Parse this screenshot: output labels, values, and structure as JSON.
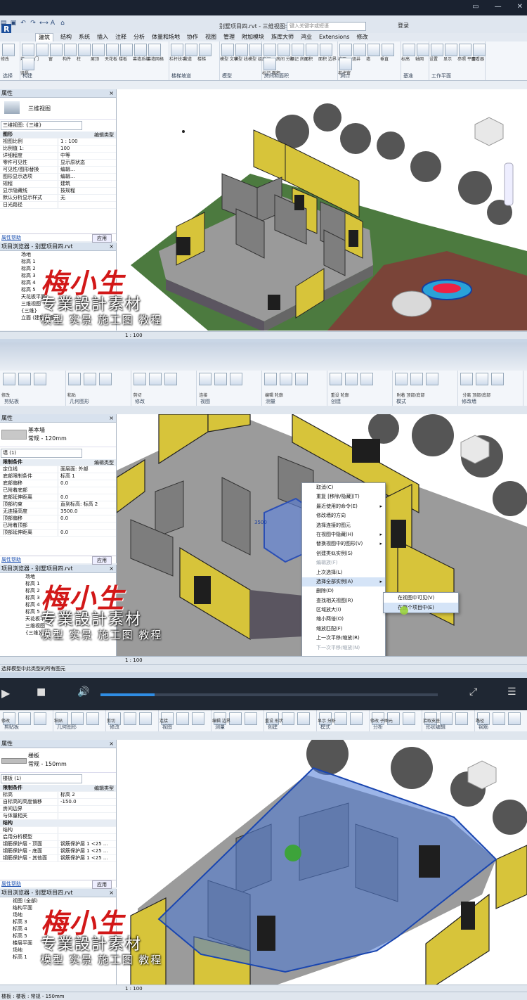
{
  "frame1": {
    "doc_title": "别墅项目四.rvt - 三维视图:...",
    "search_placeholder": "键入关键字或短语",
    "login": "登录",
    "menu_tabs": [
      "建筑",
      "结构",
      "系统",
      "插入",
      "注释",
      "分析",
      "体量和场地",
      "协作",
      "视图",
      "管理",
      "附加模块",
      "族库大师",
      "鸿业",
      "Extensions",
      "修改"
    ],
    "ribbon_groups": [
      {
        "name": "选择",
        "items": [
          "修改"
        ]
      },
      {
        "name": "构建",
        "items": [
          "墙",
          "门",
          "窗",
          "构件",
          "柱",
          "屋顶",
          "天花板",
          "楼板",
          "幕墙系统",
          "幕墙网格",
          "竖梃"
        ]
      },
      {
        "name": "楼梯坡道",
        "items": [
          "栏杆扶手",
          "坡道",
          "楼梯"
        ]
      },
      {
        "name": "模型",
        "items": [
          "模型 文字",
          "模型 线",
          "模型 组"
        ]
      },
      {
        "name": "房间和面积",
        "items": [
          "房间",
          "房间 分隔",
          "标记 房间",
          "面积",
          "面积 边界",
          "标记 面积"
        ]
      },
      {
        "name": "洞口",
        "items": [
          "按面",
          "竖井",
          "墙",
          "垂直",
          "老虎窗"
        ]
      },
      {
        "name": "基准",
        "items": [
          "标高",
          "轴网"
        ]
      },
      {
        "name": "工作平面",
        "items": [
          "设置",
          "显示",
          "参照 平面",
          "查看器"
        ]
      }
    ],
    "properties": {
      "title": "属性",
      "type_name": "三维视图",
      "selector": "三维视图: {三维}",
      "edit_type": "编辑类型",
      "section": "图形",
      "rows": [
        {
          "k": "视图比例",
          "v": "1 : 100"
        },
        {
          "k": "比例值 1:",
          "v": "100"
        },
        {
          "k": "详细程度",
          "v": "中等"
        },
        {
          "k": "零件可见性",
          "v": "显示原状态"
        },
        {
          "k": "可见性/图形替换",
          "v": "编辑..."
        },
        {
          "k": "图形显示选项",
          "v": "编辑..."
        },
        {
          "k": "规程",
          "v": "建筑"
        },
        {
          "k": "显示隐藏线",
          "v": "按规程"
        },
        {
          "k": "默认分析显示样式",
          "v": "无"
        },
        {
          "k": "日光路径",
          "v": ""
        }
      ],
      "help": "属性帮助",
      "apply": "应用"
    },
    "browser": {
      "title": "项目浏览器 - 别墅项目四.rvt",
      "items": [
        "场地",
        "标高 1",
        "标高 2",
        "标高 3",
        "标高 4",
        "标高 5",
        "天花板平面",
        "三维视图",
        "{三维}",
        "立面 (建筑立面)"
      ]
    },
    "status": "1 : 100"
  },
  "frame2": {
    "ribbon_groups": [
      "剪贴板",
      "几何图形",
      "修改",
      "视图",
      "测量",
      "创建",
      "模式",
      "修改墙"
    ],
    "ribbon_items": [
      "修改",
      "粘贴",
      "剪切",
      "连接",
      "编辑 轮廓",
      "重设 轮廓",
      "附着 顶部/底部",
      "分离 顶部/底部"
    ],
    "properties": {
      "title": "属性",
      "type_name": "基本墙",
      "type_sub": "常规 - 120mm",
      "selector": "墙 (1)",
      "edit_type": "编辑类型",
      "section": "限制条件",
      "rows": [
        {
          "k": "定位线",
          "v": "面层面: 外部"
        },
        {
          "k": "底部限制条件",
          "v": "标高 1"
        },
        {
          "k": "底部偏移",
          "v": "0.0"
        },
        {
          "k": "已附着底部",
          "v": ""
        },
        {
          "k": "底部延伸距离",
          "v": "0.0"
        },
        {
          "k": "顶部约束",
          "v": "直到标高: 标高 2"
        },
        {
          "k": "无连接高度",
          "v": "3500.0"
        },
        {
          "k": "顶部偏移",
          "v": "0.0"
        },
        {
          "k": "已附着顶部",
          "v": ""
        },
        {
          "k": "顶部延伸距离",
          "v": "0.0"
        }
      ],
      "help": "属性帮助",
      "apply": "应用"
    },
    "browser": {
      "title": "项目浏览器 - 别墅项目四.rvt",
      "items": [
        "场地",
        "标高 1",
        "标高 2",
        "标高 3",
        "标高 4",
        "标高 5",
        "天花板平面",
        "三维视图",
        "{三维}"
      ]
    },
    "context_menu": [
      {
        "label": "取消(C)",
        "dis": false
      },
      {
        "label": "重复 [移除/隐藏](T)",
        "dis": false
      },
      {
        "label": "最近使用的命令(E)",
        "dis": false,
        "arrow": true
      },
      {
        "label": "修改墙的方向",
        "dis": false
      },
      {
        "label": "选择连接的图元",
        "dis": false
      },
      {
        "label": "在视图中隐藏(H)",
        "dis": false,
        "arrow": true
      },
      {
        "label": "替换视图中的图形(V)",
        "dis": false,
        "arrow": true
      },
      {
        "label": "创建类似实例(S)",
        "dis": false
      },
      {
        "label": "编辑族(F)",
        "dis": true
      },
      {
        "label": "上次选择(L)",
        "dis": false
      },
      {
        "label": "选择全部实例(A)",
        "dis": false,
        "arrow": true,
        "hl": true
      },
      {
        "label": "删除(D)",
        "dis": false
      },
      {
        "label": "查找相关视图(R)",
        "dis": false
      },
      {
        "label": "区域放大(I)",
        "dis": false
      },
      {
        "label": "缩小两倍(O)",
        "dis": false
      },
      {
        "label": "缩放匹配(F)",
        "dis": false
      },
      {
        "label": "上一次平移/缩放(R)",
        "dis": false
      },
      {
        "label": "下一次平移/缩放(N)",
        "dis": true
      }
    ],
    "submenu": [
      "在视图中可见(V)",
      "在整个项目中(E)"
    ],
    "temp_dim": "3500",
    "status": "选择模型中此类型的所有图元",
    "status_scale": "1 : 100"
  },
  "frame3": {
    "ribbon_groups": [
      "剪贴板",
      "几何图形",
      "修改",
      "视图",
      "测量",
      "创建",
      "模式",
      "分析",
      "形状编辑",
      "钢筋"
    ],
    "ribbon_items": [
      "修改",
      "粘贴",
      "剪切",
      "连接",
      "编辑 边界",
      "重设 形状",
      "显示 分析",
      "修改 子图元",
      "拾取支座",
      "路径"
    ],
    "properties": {
      "title": "属性",
      "type_name": "楼板",
      "type_sub": "常规 - 150mm",
      "selector": "楼板 (1)",
      "edit_type": "编辑类型",
      "section": "限制条件",
      "rows": [
        {
          "k": "标高",
          "v": "标高 2"
        },
        {
          "k": "自标高的高度偏移",
          "v": "-150.0"
        },
        {
          "k": "房间边界",
          "v": ""
        },
        {
          "k": "与体量相关",
          "v": ""
        }
      ],
      "section2": "结构",
      "rows2": [
        {
          "k": "结构",
          "v": ""
        },
        {
          "k": "启用分析模型",
          "v": ""
        },
        {
          "k": "钢筋保护层 - 顶面",
          "v": "钢筋保护层 1 <25 ..."
        },
        {
          "k": "钢筋保护层 - 底面",
          "v": "钢筋保护层 1 <25 ..."
        },
        {
          "k": "钢筋保护层 - 其他面",
          "v": "钢筋保护层 1 <25 ..."
        }
      ],
      "help": "属性帮助",
      "apply": "应用"
    },
    "browser": {
      "title": "项目浏览器 - 别墅项目四.rvt",
      "items": [
        "视图 (全部)",
        "结构平面",
        "场地",
        "标高 3",
        "标高 4",
        "标高 5",
        "楼层平面",
        "场地",
        "标高 1"
      ]
    },
    "status": "楼板 : 楼板 : 常规 - 150mm",
    "status_scale": "1 : 100"
  },
  "watermark": {
    "brand": "梅小生",
    "line1": "专業設計素材",
    "line2": "模型 实景 施工图 教程"
  },
  "colors": {
    "wall_yellow": "#d7c43a",
    "grass": "#44693a",
    "select_blue": "#4a78d6"
  }
}
